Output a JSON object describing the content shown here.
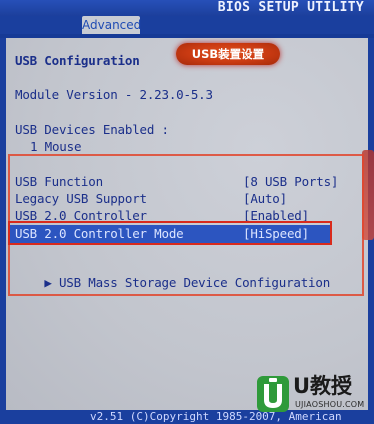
{
  "header": {
    "title": "BIOS SETUP UTILITY",
    "active_tab": "Advanced"
  },
  "annotation": {
    "badge_text": "USB装置设置"
  },
  "section": {
    "heading": "USB Configuration",
    "module_version": "Module Version - 2.23.0-5.3",
    "devices_label": "USB Devices Enabled :",
    "devices_value": "1 Mouse"
  },
  "settings": [
    {
      "label": "USB Function",
      "value": "[8 USB Ports]"
    },
    {
      "label": "Legacy USB Support",
      "value": "[Auto]"
    },
    {
      "label": "USB 2.0 Controller",
      "value": "[Enabled]"
    },
    {
      "label": "USB 2.0 Controller Mode",
      "value": "[HiSpeed]",
      "selected": true
    }
  ],
  "submenu": {
    "arrow": "▶",
    "label": "USB Mass Storage Device Configuration"
  },
  "footer": {
    "copyright": "v2.51 (C)Copyright 1985-2007, American"
  },
  "watermark": {
    "brand": "U教授",
    "site": "UJIAOSHOU.COM"
  },
  "colors": {
    "bios_blue": "#1a3f9e",
    "panel_gray": "#c4c7cf",
    "text_blue": "#1b2f8a",
    "highlight_blue": "#2c55c0",
    "annotation_red": "#d92a1c",
    "logo_green": "#2f9a3a"
  }
}
